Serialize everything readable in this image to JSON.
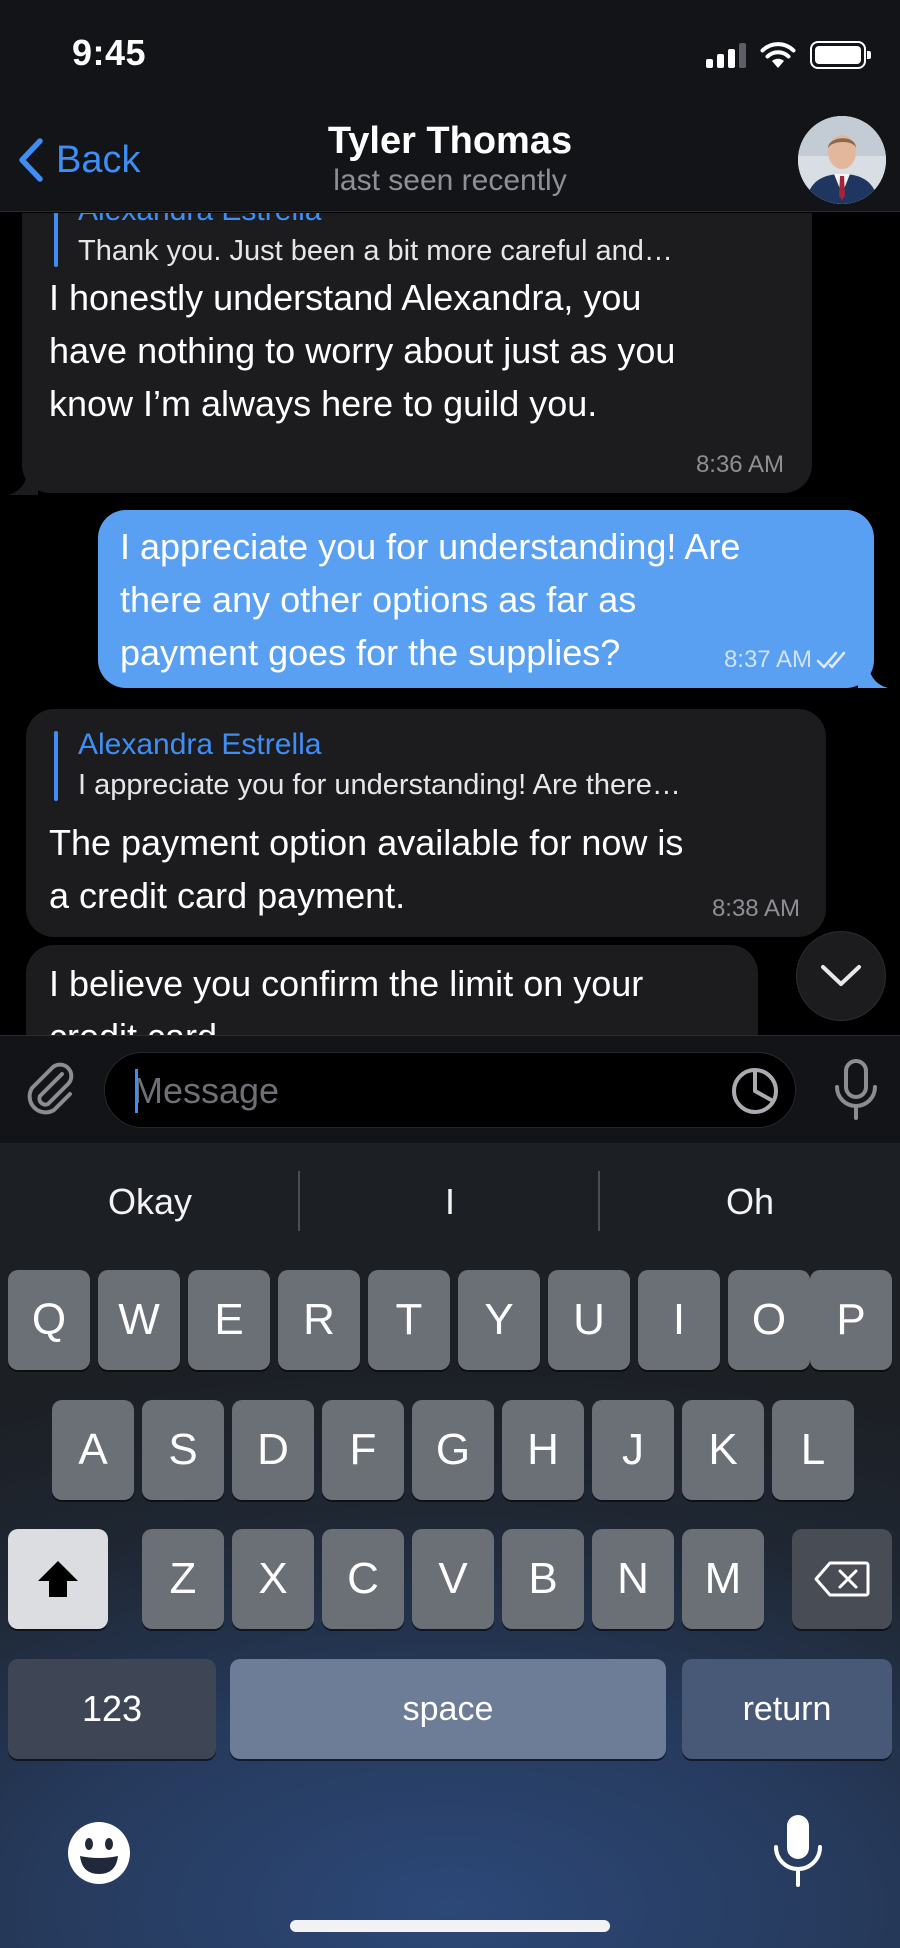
{
  "status_bar": {
    "time": "9:45"
  },
  "nav": {
    "back_label": "Back",
    "title": "Tyler Thomas",
    "subtitle": "last seen recently"
  },
  "messages": [
    {
      "direction": "incoming",
      "reply_to_name": "Alexandra Estrella",
      "reply_to_text": "Thank you. Just been a bit more careful and…",
      "lines": [
        "I honestly understand Alexandra, you",
        "have nothing to worry about just as you",
        "know I’m always here to guild you."
      ],
      "time": "8:36 AM"
    },
    {
      "direction": "outgoing",
      "lines": [
        "I appreciate you for understanding! Are",
        "there any other options as far as",
        "payment goes for the supplies?"
      ],
      "time": "8:37 AM",
      "read": true
    },
    {
      "direction": "incoming",
      "reply_to_name": "Alexandra Estrella",
      "reply_to_text": "I appreciate you for understanding! Are there…",
      "lines": [
        "The payment option available for now is",
        "a credit card payment."
      ],
      "time": "8:38 AM"
    },
    {
      "direction": "incoming",
      "lines": [
        "I believe you confirm the limit on your",
        "credit card"
      ]
    }
  ],
  "composer": {
    "placeholder": "Message"
  },
  "keyboard": {
    "suggestions": [
      "Okay",
      "I",
      "Oh"
    ],
    "row1": [
      "Q",
      "W",
      "E",
      "R",
      "T",
      "Y",
      "U",
      "I",
      "O",
      "P"
    ],
    "row2": [
      "A",
      "S",
      "D",
      "F",
      "G",
      "H",
      "J",
      "K",
      "L"
    ],
    "row3": [
      "Z",
      "X",
      "C",
      "V",
      "B",
      "N",
      "M"
    ],
    "numbers_label": "123",
    "space_label": "space",
    "return_label": "return"
  },
  "colors": {
    "accent": "#3f8ef5",
    "outgoing_bubble": "#5aa0f2",
    "incoming_bubble": "#1c1c1e"
  },
  "icons": [
    "back-chevron-icon",
    "signal-icon",
    "wifi-icon",
    "battery-icon",
    "attach-paperclip-icon",
    "sticker-icon",
    "microphone-icon",
    "chevron-down-icon",
    "shift-arrow-icon",
    "backspace-icon",
    "emoji-icon",
    "double-check-icon"
  ]
}
